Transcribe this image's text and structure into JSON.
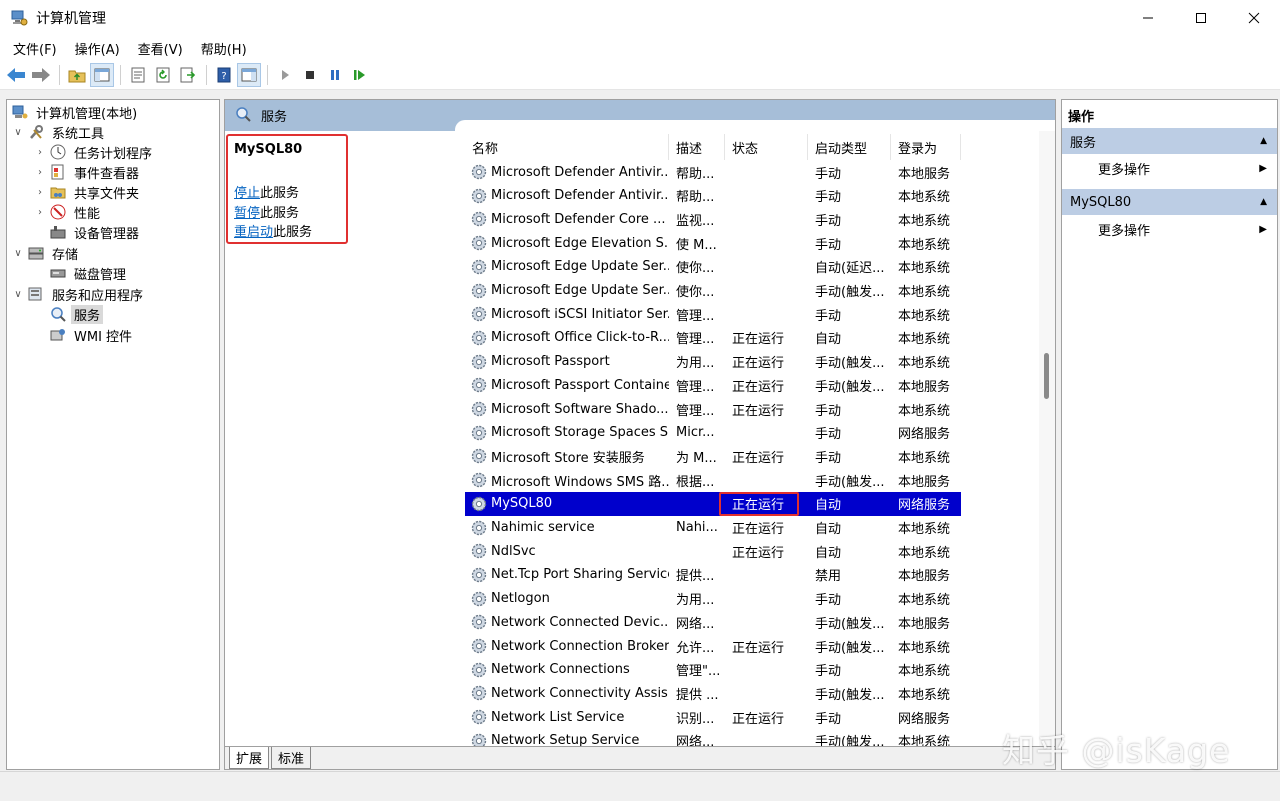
{
  "window": {
    "title": "计算机管理",
    "title_icon": "computer-management-icon"
  },
  "menu": [
    {
      "label": "文件(F)"
    },
    {
      "label": "操作(A)"
    },
    {
      "label": "查看(V)"
    },
    {
      "label": "帮助(H)"
    }
  ],
  "tree": {
    "root": "计算机管理(本地)",
    "system_tools": "系统工具",
    "task_scheduler": "任务计划程序",
    "event_viewer": "事件查看器",
    "shared_folders": "共享文件夹",
    "performance": "性能",
    "device_manager": "设备管理器",
    "storage": "存储",
    "disk_management": "磁盘管理",
    "services_apps": "服务和应用程序",
    "services": "服务",
    "wmi": "WMI 控件"
  },
  "center": {
    "header_title": "服务",
    "selected_service": "MySQL80",
    "actions": [
      {
        "link": "停止",
        "suffix": "此服务"
      },
      {
        "link": "暂停",
        "suffix": "此服务"
      },
      {
        "link": "重启动",
        "suffix": "此服务"
      }
    ],
    "columns": [
      "名称",
      "描述",
      "状态",
      "启动类型",
      "登录为"
    ],
    "rows": [
      {
        "name": "Microsoft Defender Antivir...",
        "desc": "帮助...",
        "status": "",
        "startup": "手动",
        "logon": "本地服务"
      },
      {
        "name": "Microsoft Defender Antivir...",
        "desc": "帮助...",
        "status": "",
        "startup": "手动",
        "logon": "本地系统"
      },
      {
        "name": "Microsoft Defender Core ...",
        "desc": "监视...",
        "status": "",
        "startup": "手动",
        "logon": "本地系统"
      },
      {
        "name": "Microsoft Edge Elevation S...",
        "desc": "使 M...",
        "status": "",
        "startup": "手动",
        "logon": "本地系统"
      },
      {
        "name": "Microsoft Edge Update Ser...",
        "desc": "使你...",
        "status": "",
        "startup": "自动(延迟...",
        "logon": "本地系统"
      },
      {
        "name": "Microsoft Edge Update Ser...",
        "desc": "使你...",
        "status": "",
        "startup": "手动(触发...",
        "logon": "本地系统"
      },
      {
        "name": "Microsoft iSCSI Initiator Ser...",
        "desc": "管理...",
        "status": "",
        "startup": "手动",
        "logon": "本地系统"
      },
      {
        "name": "Microsoft Office Click-to-R...",
        "desc": "管理...",
        "status": "正在运行",
        "startup": "自动",
        "logon": "本地系统"
      },
      {
        "name": "Microsoft Passport",
        "desc": "为用...",
        "status": "正在运行",
        "startup": "手动(触发...",
        "logon": "本地系统"
      },
      {
        "name": "Microsoft Passport Container",
        "desc": "管理...",
        "status": "正在运行",
        "startup": "手动(触发...",
        "logon": "本地服务"
      },
      {
        "name": "Microsoft Software Shado...",
        "desc": "管理...",
        "status": "正在运行",
        "startup": "手动",
        "logon": "本地系统"
      },
      {
        "name": "Microsoft Storage Spaces S...",
        "desc": "Micr...",
        "status": "",
        "startup": "手动",
        "logon": "网络服务"
      },
      {
        "name": "Microsoft Store 安装服务",
        "desc": "为 M...",
        "status": "正在运行",
        "startup": "手动",
        "logon": "本地系统"
      },
      {
        "name": "Microsoft Windows SMS 路...",
        "desc": "根据...",
        "status": "",
        "startup": "手动(触发...",
        "logon": "本地服务"
      },
      {
        "name": "MySQL80",
        "desc": "",
        "status": "正在运行",
        "startup": "自动",
        "logon": "网络服务",
        "selected": true
      },
      {
        "name": "Nahimic service",
        "desc": "Nahi...",
        "status": "正在运行",
        "startup": "自动",
        "logon": "本地系统"
      },
      {
        "name": "NdlSvc",
        "desc": "",
        "status": "正在运行",
        "startup": "自动",
        "logon": "本地系统"
      },
      {
        "name": "Net.Tcp Port Sharing Service",
        "desc": "提供...",
        "status": "",
        "startup": "禁用",
        "logon": "本地服务"
      },
      {
        "name": "Netlogon",
        "desc": "为用...",
        "status": "",
        "startup": "手动",
        "logon": "本地系统"
      },
      {
        "name": "Network Connected Devic...",
        "desc": "网络...",
        "status": "",
        "startup": "手动(触发...",
        "logon": "本地服务"
      },
      {
        "name": "Network Connection Broker",
        "desc": "允许...",
        "status": "正在运行",
        "startup": "手动(触发...",
        "logon": "本地系统"
      },
      {
        "name": "Network Connections",
        "desc": "管理\"...",
        "status": "",
        "startup": "手动",
        "logon": "本地系统"
      },
      {
        "name": "Network Connectivity Assis...",
        "desc": "提供 ...",
        "status": "",
        "startup": "手动(触发...",
        "logon": "本地系统"
      },
      {
        "name": "Network List Service",
        "desc": "识别...",
        "status": "正在运行",
        "startup": "手动",
        "logon": "网络服务"
      },
      {
        "name": "Network Setup Service",
        "desc": "网络...",
        "status": "",
        "startup": "手动(触发...",
        "logon": "本地系统"
      }
    ],
    "tabs": [
      "扩展",
      "标准"
    ]
  },
  "actions_pane": {
    "header": "操作",
    "sections": [
      {
        "title": "服务",
        "item": "更多操作"
      },
      {
        "title": "MySQL80",
        "item": "更多操作"
      }
    ]
  },
  "watermark": "知乎 @isKage",
  "colors": {
    "selection": "#0000cc",
    "section_bg": "#bccde4",
    "header_bg": "#a6bed8",
    "highlight_border": "#e03030",
    "link": "#0563c1"
  }
}
